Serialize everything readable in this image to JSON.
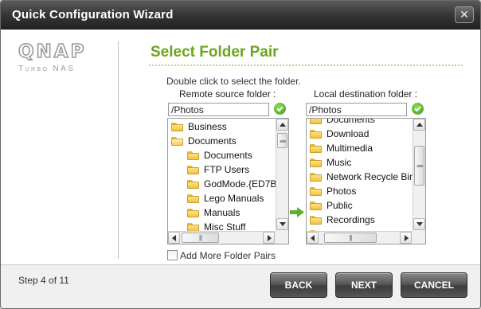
{
  "window": {
    "title": "Quick Configuration Wizard"
  },
  "branding": {
    "brand": "QNAP",
    "tagline": "Turbo NAS"
  },
  "page": {
    "heading": "Select Folder Pair",
    "hint": "Double click to select the folder."
  },
  "source": {
    "label": "Remote source folder :",
    "path": "/Photos",
    "items": [
      {
        "label": "Business",
        "level": 0,
        "open": false
      },
      {
        "label": "Documents",
        "level": 0,
        "open": true
      },
      {
        "label": "Documents",
        "level": 1,
        "open": false
      },
      {
        "label": "FTP Users",
        "level": 1,
        "open": false
      },
      {
        "label": "GodMode.{ED7B",
        "level": 1,
        "open": false
      },
      {
        "label": "Lego Manuals",
        "level": 1,
        "open": false
      },
      {
        "label": "Manuals",
        "level": 1,
        "open": false
      },
      {
        "label": "Misc Stuff",
        "level": 1,
        "open": false
      }
    ]
  },
  "destination": {
    "label": "Local destination folder :",
    "path": "/Photos",
    "items": [
      {
        "label": "Documents",
        "level": 0,
        "open": false
      },
      {
        "label": "Download",
        "level": 0,
        "open": false
      },
      {
        "label": "Multimedia",
        "level": 0,
        "open": false
      },
      {
        "label": "Music",
        "level": 0,
        "open": false
      },
      {
        "label": "Network Recycle Bin",
        "level": 0,
        "open": false
      },
      {
        "label": "Photos",
        "level": 0,
        "open": false
      },
      {
        "label": "Public",
        "level": 0,
        "open": false
      },
      {
        "label": "Recordings",
        "level": 0,
        "open": false
      }
    ]
  },
  "options": {
    "add_more_label": "Add More Folder Pairs",
    "add_more_checked": false
  },
  "footer": {
    "step": "Step 4 of 11",
    "back_label": "BACK",
    "next_label": "NEXT",
    "cancel_label": "CANCEL"
  },
  "colors": {
    "accent_green": "#6aa51a",
    "titlebar": "#333333"
  }
}
